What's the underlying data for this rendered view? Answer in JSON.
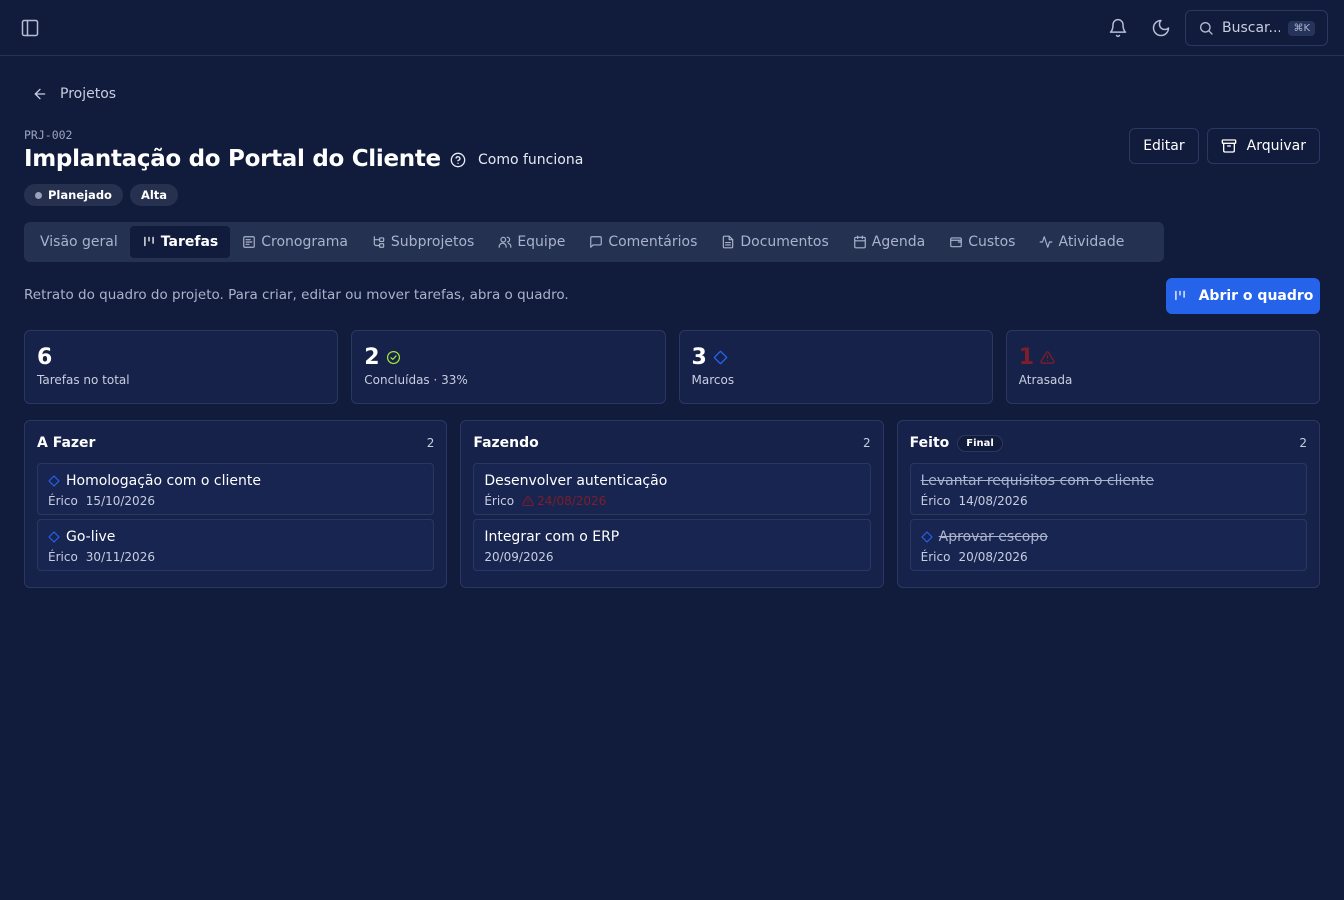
{
  "topbar": {
    "search_placeholder": "Buscar...",
    "search_shortcut": "⌘K"
  },
  "breadcrumb": {
    "back_label": "Projetos"
  },
  "project": {
    "code": "PRJ-002",
    "title": "Implantação do Portal do Cliente",
    "how_it_works": "Como funciona",
    "status": "Planejado",
    "priority": "Alta"
  },
  "actions": {
    "edit": "Editar",
    "archive": "Arquivar"
  },
  "tabs": [
    {
      "label": "Visão geral",
      "icon": "none"
    },
    {
      "label": "Tarefas",
      "icon": "kanban-icon"
    },
    {
      "label": "Cronograma",
      "icon": "gantt-icon"
    },
    {
      "label": "Subprojetos",
      "icon": "tree-icon"
    },
    {
      "label": "Equipe",
      "icon": "users-icon"
    },
    {
      "label": "Comentários",
      "icon": "message-icon"
    },
    {
      "label": "Documentos",
      "icon": "file-icon"
    },
    {
      "label": "Agenda",
      "icon": "calendar-icon"
    },
    {
      "label": "Custos",
      "icon": "wallet-icon"
    },
    {
      "label": "Atividade",
      "icon": "activity-icon"
    }
  ],
  "active_tab": "Tarefas",
  "description": "Retrato do quadro do projeto. Para criar, editar ou mover tarefas, abra o quadro.",
  "open_board": "Abrir o quadro",
  "stats": [
    {
      "value": "6",
      "label": "Tarefas no total"
    },
    {
      "value": "2",
      "label": "Concluídas · 33%"
    },
    {
      "value": "3",
      "label": "Marcos"
    },
    {
      "value": "1",
      "label": "Atrasada"
    }
  ],
  "colors": {
    "accent": "#2563eb",
    "danger": "#7f1d2a",
    "success": "#a3e635",
    "background": "#111c3c"
  },
  "columns": [
    {
      "title": "A Fazer",
      "tag": "",
      "count": "2",
      "cards": [
        {
          "title": "Homologação com o cliente",
          "milestone": true,
          "assignee": "Érico",
          "date": "15/10/2026"
        },
        {
          "title": "Go-live",
          "milestone": true,
          "assignee": "Érico",
          "date": "30/11/2026"
        }
      ]
    },
    {
      "title": "Fazendo",
      "tag": "",
      "count": "2",
      "cards": [
        {
          "title": "Desenvolver autenticação",
          "milestone": false,
          "assignee": "Érico",
          "date": "24/08/2026"
        },
        {
          "title": "Integrar com o ERP",
          "milestone": false,
          "assignee": "",
          "date": "20/09/2026"
        }
      ]
    },
    {
      "title": "Feito",
      "tag": "Final",
      "count": "2",
      "cards": [
        {
          "title": "Levantar requisitos com o cliente",
          "milestone": false,
          "assignee": "Érico",
          "date": "14/08/2026"
        },
        {
          "title": "Aprovar escopo",
          "milestone": true,
          "assignee": "Érico",
          "date": "20/08/2026"
        }
      ]
    }
  ]
}
